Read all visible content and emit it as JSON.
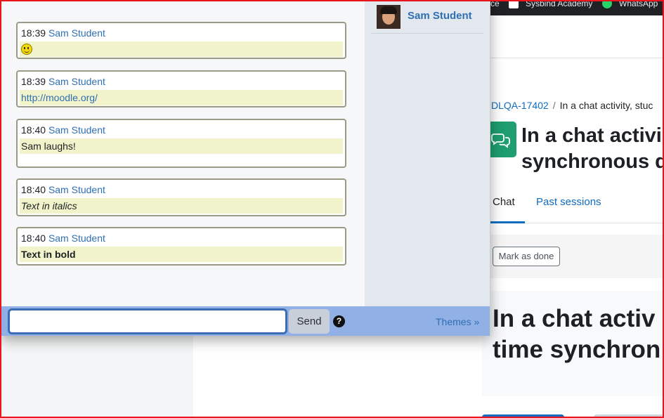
{
  "background_page": {
    "bookmarks": {
      "item_prefix": "ce",
      "sysbind": "Sysbind Academy",
      "whatsapp": "WhatsApp"
    },
    "breadcrumb": {
      "course": "DLQA-17402",
      "separator": "/",
      "current": "In a chat activity, stuc"
    },
    "activity_icon": "chat-bubbles-icon",
    "title_line1": "In a chat activi",
    "title_line2": "synchronous d",
    "tabs": {
      "chat": "Chat",
      "past_sessions": "Past sessions"
    },
    "mark_done_label": "Mark as done",
    "heading_line1": "In a chat activ",
    "heading_line2": "time synchron"
  },
  "chat": {
    "messages": [
      {
        "time": "18:39",
        "user": "Sam Student",
        "content": "",
        "content_icon": "smiley-icon"
      },
      {
        "time": "18:39",
        "user": "Sam Student",
        "content": "http://moodle.org/",
        "type": "link"
      },
      {
        "time": "18:40",
        "user": "Sam Student",
        "content": "Sam laughs!",
        "type": "emote"
      },
      {
        "time": "18:40",
        "user": "Sam Student",
        "content": "Text in italics",
        "type": "italic"
      },
      {
        "time": "18:40",
        "user": "Sam Student",
        "content": "Text in bold",
        "type": "bold"
      }
    ],
    "users": [
      {
        "name": "Sam Student",
        "avatar": "avatar-photo"
      }
    ],
    "input": {
      "value": "",
      "placeholder": ""
    },
    "send_label": "Send",
    "help_icon": "question-circle-icon",
    "help_glyph": "?",
    "themes_label": "Themes »"
  },
  "colors": {
    "accent_link": "#2f6fb3",
    "input_bar": "#90b0e6",
    "message_highlight": "#f1f4cb",
    "frame_border": "#e8161c",
    "activity_green": "#1f9e6f"
  }
}
